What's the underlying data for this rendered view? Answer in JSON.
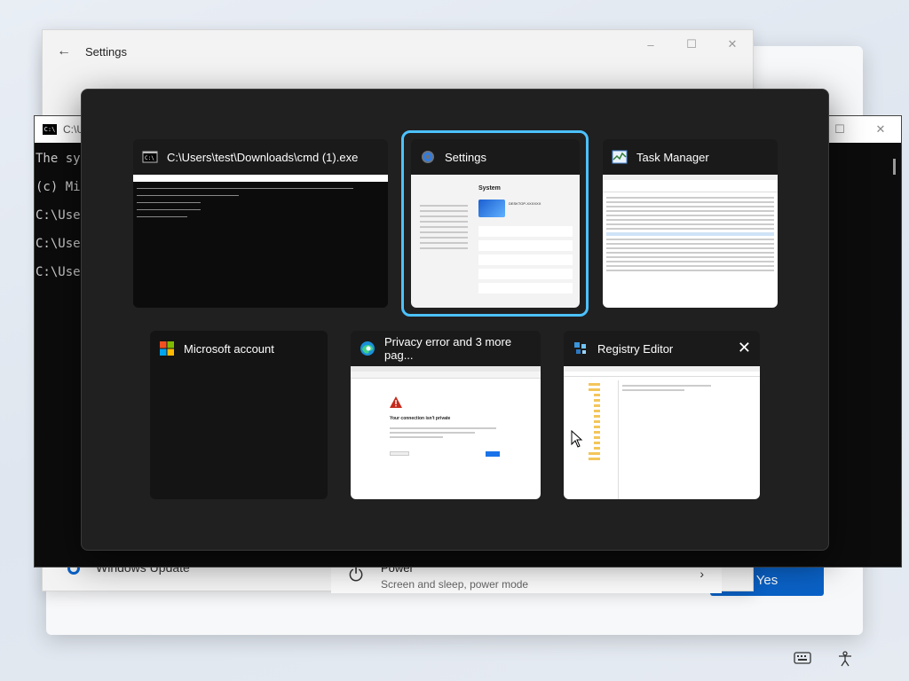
{
  "settings": {
    "title": "Settings",
    "power_title": "Power",
    "power_sub": "Screen and sleep, power mode",
    "windows_update": "Windows Update"
  },
  "uac": {
    "yes_label": "Yes"
  },
  "cmd": {
    "title": "C:\\U",
    "lines": [
      "The sys",
      "(c) Mic",
      "C:\\User",
      "C:\\User",
      "C:\\User"
    ]
  },
  "switcher": {
    "windows": [
      {
        "title": "C:\\Users\\test\\Downloads\\cmd (1).exe"
      },
      {
        "title": "Settings",
        "selected": true
      },
      {
        "title": "Task Manager"
      },
      {
        "title": "Microsoft account"
      },
      {
        "title": "Privacy error and 3 more pag..."
      },
      {
        "title": "Registry Editor"
      }
    ],
    "settings_preview": {
      "heading": "System",
      "device": "DESKTOP-XXXXXX"
    },
    "edge_preview": {
      "headline": "Your connection isn't private"
    }
  },
  "tray": {
    "keyboard_icon": "keyboard-icon",
    "accessibility_icon": "accessibility-icon"
  },
  "colors": {
    "accent": "#4cc2ff",
    "uac_button": "#0a62c7",
    "overlay": "#202020"
  }
}
